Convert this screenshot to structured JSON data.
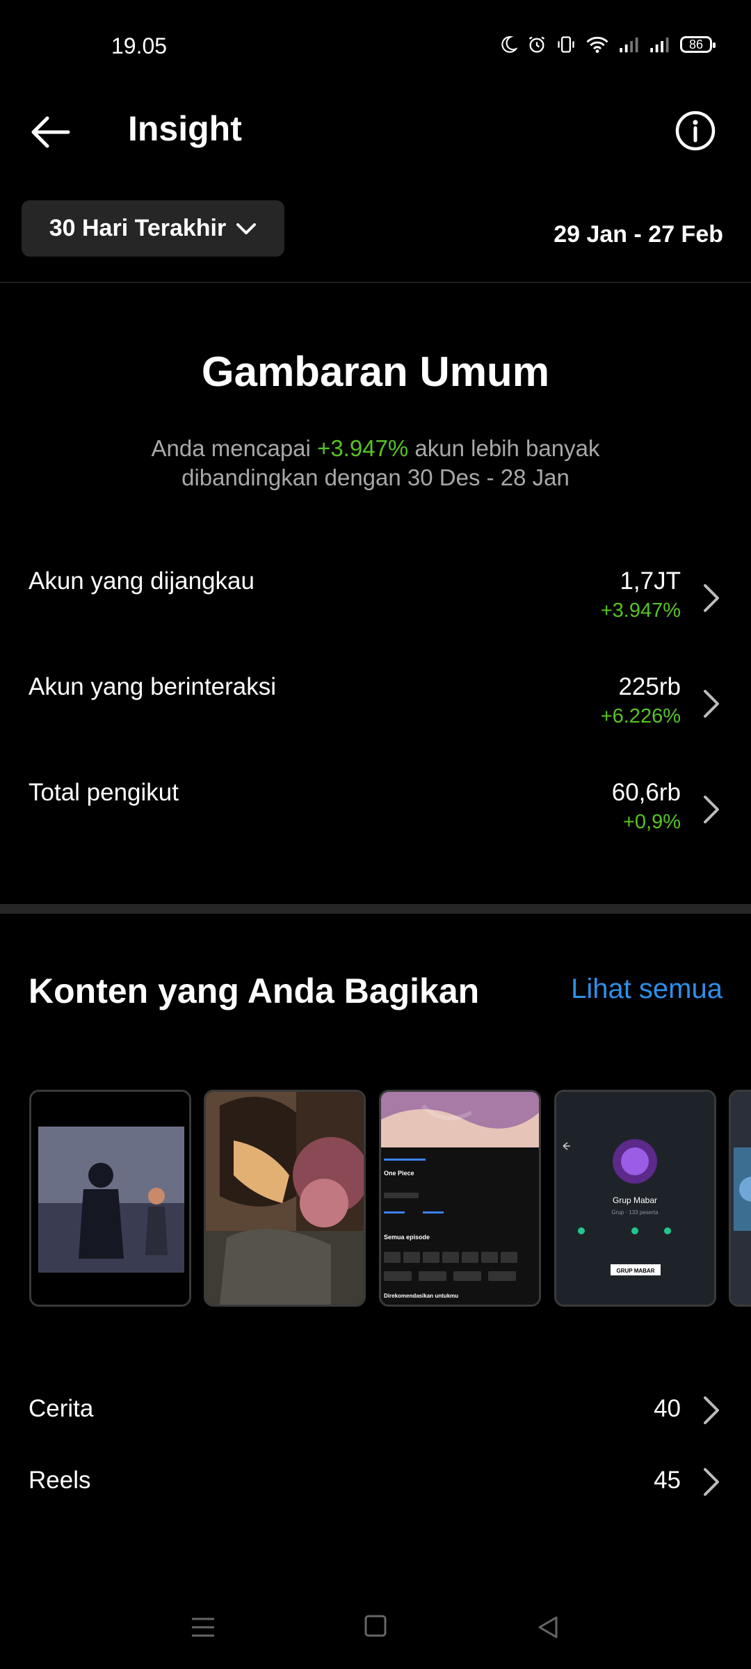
{
  "status_bar": {
    "time": "19.05",
    "battery": "86"
  },
  "header": {
    "title": "Insight"
  },
  "filter": {
    "range_label": "30 Hari Terakhir",
    "date_range": "29 Jan - 27 Feb"
  },
  "overview": {
    "title": "Gambaran Umum",
    "sub_prefix": "Anda mencapai ",
    "sub_highlight": "+3.947%",
    "sub_suffix": " akun lebih banyak dibandingkan dengan 30 Des - 28 Jan"
  },
  "metrics": [
    {
      "label": "Akun yang dijangkau",
      "value": "1,7JT",
      "change": "+3.947%"
    },
    {
      "label": "Akun yang berinteraksi",
      "value": "225rb",
      "change": "+6.226%"
    },
    {
      "label": "Total pengikut",
      "value": "60,6rb",
      "change": "+0,9%"
    }
  ],
  "content": {
    "title": "Konten yang Anda Bagikan",
    "see_all": "Lihat semua",
    "thumb_4": {
      "group_name": "Grup Mabar",
      "group_sub": "Grup · 133 peserta",
      "badge": "GRUP MABAR"
    },
    "thumb_3": {
      "show_title": "One Piece",
      "section": "Semua episode",
      "recommend": "Direkomendasikan untukmu"
    }
  },
  "counts": [
    {
      "label": "Cerita",
      "value": "40"
    },
    {
      "label": "Reels",
      "value": "45"
    }
  ],
  "colors": {
    "accent_green": "#58c322",
    "link_blue": "#2f8fe8",
    "surface": "#262626"
  }
}
